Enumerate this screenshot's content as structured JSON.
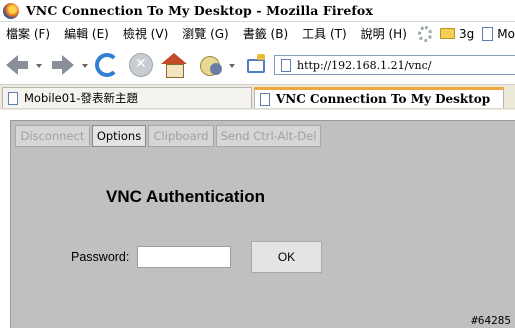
{
  "window": {
    "title": "VNC Connection To My Desktop - Mozilla Firefox"
  },
  "menu": {
    "items": [
      "檔案 (F)",
      "編輯 (E)",
      "檢視 (V)",
      "瀏覽 (G)",
      "書籤 (B)",
      "工具 (T)",
      "說明 (H)"
    ],
    "bookmarks": [
      "3g",
      "Mo"
    ]
  },
  "nav": {
    "url": "http://192.168.1.21/vnc/"
  },
  "tabs": [
    {
      "label": "Mobile01-發表新主題"
    },
    {
      "label": "VNC Connection To My Desktop"
    }
  ],
  "vnc": {
    "buttons": {
      "disconnect": "Disconnect",
      "options": "Options",
      "clipboard": "Clipboard",
      "cad": "Send Ctrl-Alt-Del"
    },
    "auth_title": "VNC Authentication",
    "password_label": "Password:",
    "password_value": "",
    "ok_label": "OK"
  },
  "watermark": "#64285"
}
